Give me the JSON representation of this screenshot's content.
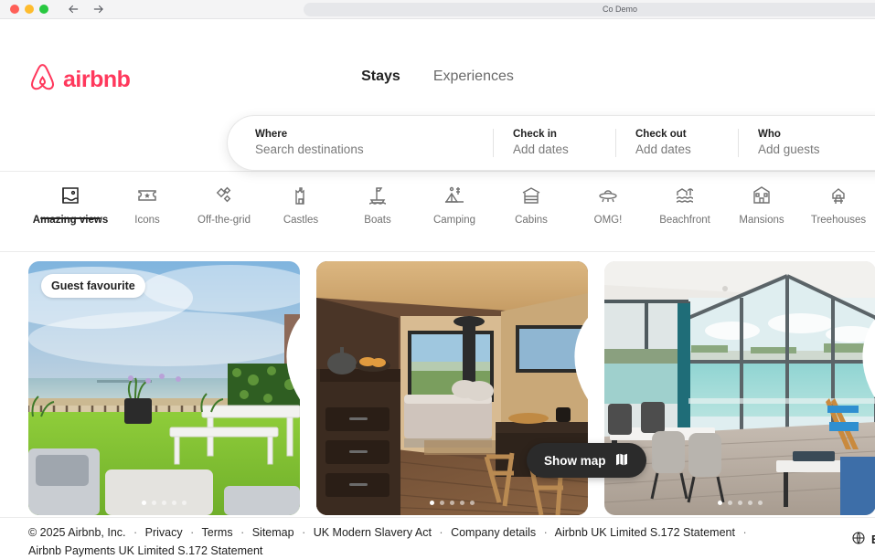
{
  "browser": {
    "title": "Co Demo",
    "back_icon": "back-arrow-icon",
    "forward_icon": "forward-arrow-icon"
  },
  "header": {
    "brand": "airbnb",
    "brand_color": "#FF385C",
    "tabs": [
      {
        "label": "Stays",
        "active": true
      },
      {
        "label": "Experiences",
        "active": false
      }
    ],
    "search": {
      "where_label": "Where",
      "where_value": "Search destinations",
      "checkin_label": "Check in",
      "checkin_value": "Add dates",
      "checkout_label": "Check out",
      "checkout_value": "Add dates",
      "who_label": "Who",
      "who_value": "Add guests"
    }
  },
  "categories": [
    {
      "label": "Amazing views",
      "icon": "amazing-views-icon",
      "active": true
    },
    {
      "label": "Icons",
      "icon": "ticket-star-icon",
      "active": false
    },
    {
      "label": "Off-the-grid",
      "icon": "diamonds-icon",
      "active": false
    },
    {
      "label": "Castles",
      "icon": "castle-icon",
      "active": false
    },
    {
      "label": "Boats",
      "icon": "boat-icon",
      "active": false
    },
    {
      "label": "Camping",
      "icon": "tent-icon",
      "active": false
    },
    {
      "label": "Cabins",
      "icon": "cabin-icon",
      "active": false
    },
    {
      "label": "OMG!",
      "icon": "ufo-icon",
      "active": false
    },
    {
      "label": "Beachfront",
      "icon": "beachfront-icon",
      "active": false
    },
    {
      "label": "Mansions",
      "icon": "mansion-icon",
      "active": false
    },
    {
      "label": "Treehouses",
      "icon": "treehouse-icon",
      "active": false
    }
  ],
  "listings": [
    {
      "badge": "Guest favourite",
      "photo_alt": "Rooftop terrace with benches overlooking a beach and sea",
      "photo_dots": 5,
      "active_dot": 1,
      "favourite": false
    },
    {
      "badge": "",
      "photo_alt": "Wood-lined cabin interior with bed, log burner and countryside window",
      "photo_dots": 5,
      "active_dot": 1,
      "favourite": false
    },
    {
      "badge": "",
      "photo_alt": "Glass-walled lakeside living and dining room with balcony",
      "photo_dots": 5,
      "active_dot": 1,
      "favourite": false
    }
  ],
  "map_button": {
    "label": "Show map",
    "icon": "map-icon"
  },
  "footer": {
    "copyright": "© 2025 Airbnb, Inc.",
    "links_line1": [
      "Privacy",
      "Terms",
      "Sitemap",
      "UK Modern Slavery Act",
      "Company details",
      "Airbnb UK Limited S.172 Statement"
    ],
    "line2": "Airbnb Payments UK Limited S.172 Statement",
    "language": "En",
    "language_icon": "globe-icon"
  }
}
